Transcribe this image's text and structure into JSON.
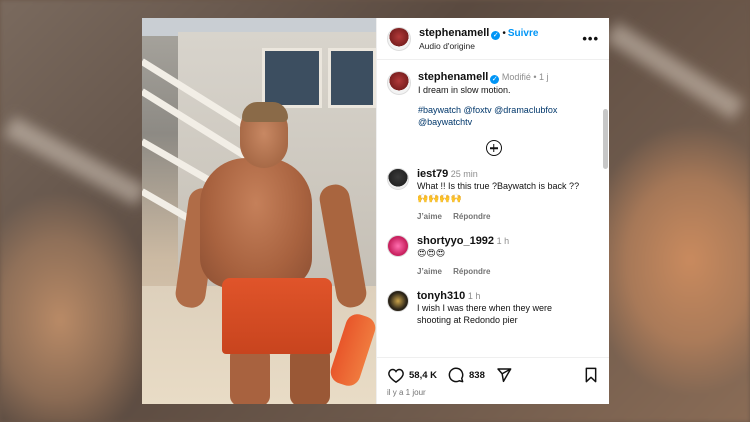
{
  "header": {
    "username": "stephenamell",
    "follow_label": "Suivre",
    "audio": "Audio d'origine",
    "more": "•••"
  },
  "caption": {
    "username": "stephenamell",
    "edited": "Modifié",
    "time": "1 j",
    "text": "I dream in slow motion.",
    "hashtags": "#baywatch @foxtv @dramaclubfox @baywatchtv"
  },
  "comments": [
    {
      "username": "iest79",
      "time": "25 min",
      "text": "What !! Is this true ?Baywatch is back ??🙌🙌🙌🙌",
      "like": "J’aime",
      "reply": "Répondre"
    },
    {
      "username": "shortyyo_1992",
      "time": "1 h",
      "text": "😍😍😍",
      "like": "J’aime",
      "reply": "Répondre"
    },
    {
      "username": "tonyh310",
      "time": "1 h",
      "text": "I wish I was there when they were shooting at Redondo pier"
    }
  ],
  "footer": {
    "likes": "58,4 K",
    "comments": "838",
    "ago": "il y a 1 jour"
  },
  "icons": {
    "heart": "heart-icon",
    "comment": "comment-icon",
    "share": "share-icon",
    "bookmark": "bookmark-icon",
    "add": "add-comment-plus-icon"
  },
  "colors": {
    "link": "#0095f6",
    "hashtag": "#00376b",
    "verified": "#0095f6"
  }
}
